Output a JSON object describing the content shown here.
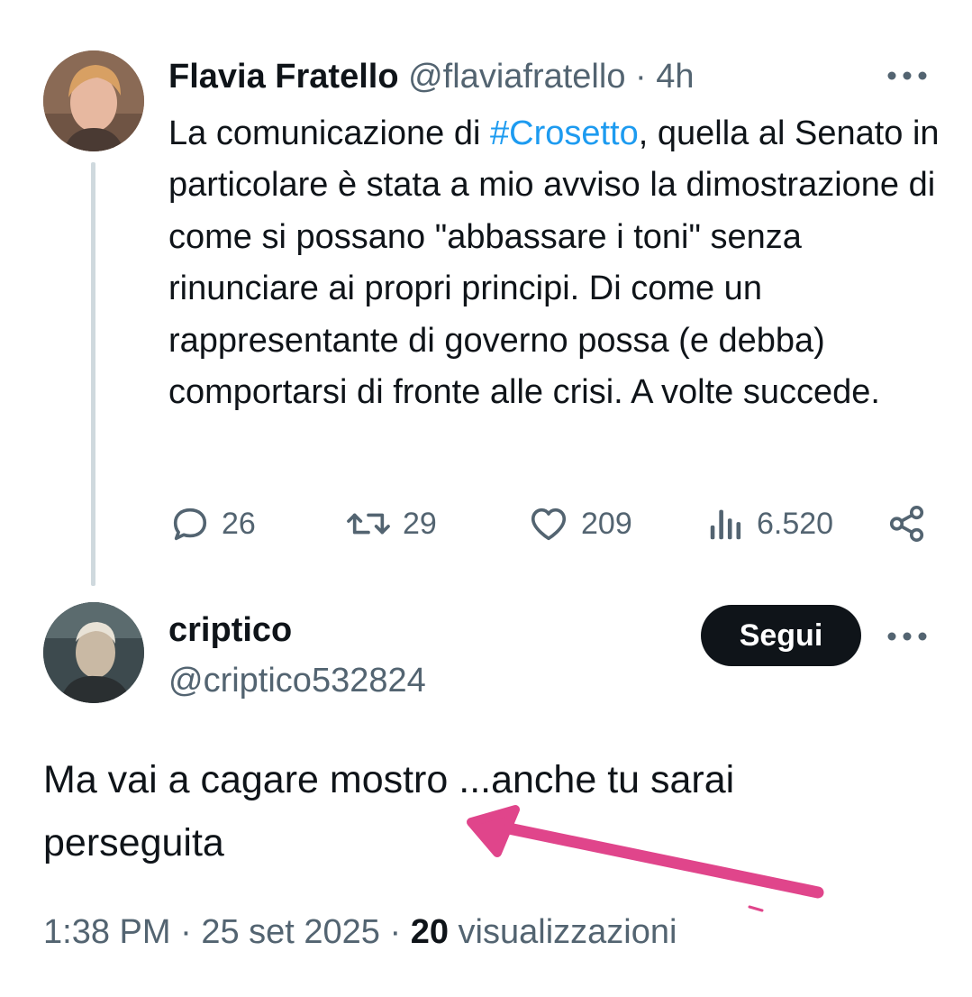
{
  "parent_tweet": {
    "author_name": "Flavia Fratello",
    "handle": "@flaviafratello",
    "separator": "·",
    "time": "4h",
    "text_before_hashtag": "La comunicazione di ",
    "hashtag": "#Crosetto",
    "text_after_hashtag": ", quella al Senato in particolare è stata a mio avviso la dimostrazione di come si possano \"abbassare i toni\" senza rinunciare ai propri principi. Di come un rappresentante di governo possa (e debba) comportarsi di fronte alle crisi. A volte succede.",
    "actions": {
      "replies": "26",
      "reposts": "29",
      "likes": "209",
      "views": "6.520"
    }
  },
  "reply_tweet": {
    "author_name": "criptico",
    "handle": "@criptico532824",
    "follow_label": "Segui",
    "text": "Ma vai a cagare mostro ...anche tu sarai perseguita",
    "time": "1:38 PM",
    "sep1": "·",
    "date": "25 set 2025",
    "sep2": "·",
    "views_count": "20",
    "views_label": "visualizzazioni"
  },
  "colors": {
    "text": "#0f1419",
    "muted": "#536471",
    "link": "#1d9bf0",
    "thread_line": "#cfd9de",
    "annotation_arrow": "#e0458b"
  },
  "icons": [
    "more-icon",
    "reply-icon",
    "repost-icon",
    "like-icon",
    "views-icon",
    "share-icon"
  ]
}
